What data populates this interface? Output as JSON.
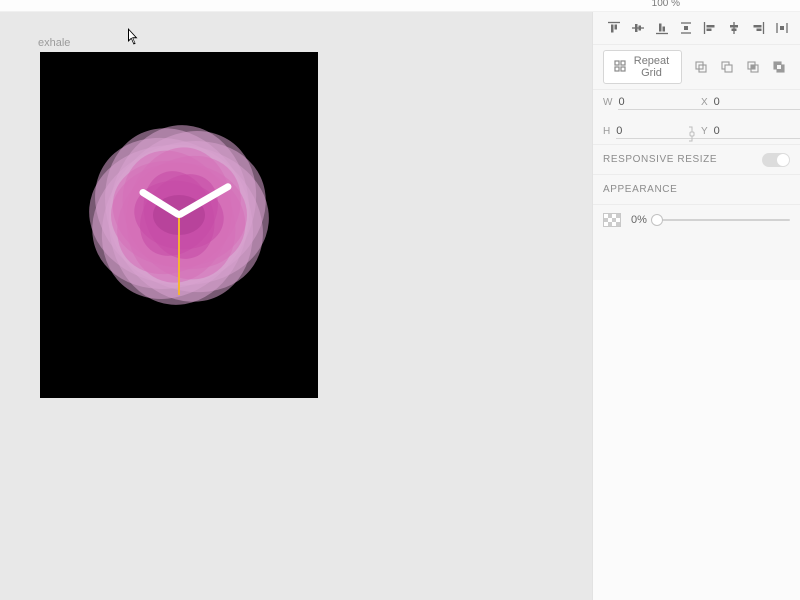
{
  "topbar": {
    "zoom_label": "100 %"
  },
  "artboard": {
    "label": "exhale"
  },
  "panel": {
    "repeat_grid_label": "Repeat Grid",
    "transform": {
      "w_label": "W",
      "w_value": "0",
      "h_label": "H",
      "h_value": "0",
      "x_label": "X",
      "x_value": "0",
      "y_label": "Y",
      "y_value": "0"
    },
    "responsive_label": "RESPONSIVE RESIZE",
    "appearance_label": "APPEARANCE",
    "opacity_value": "0%"
  },
  "icons": {
    "align_top": "align-top-icon",
    "align_vmid": "align-vertical-middle-icon",
    "align_bottom": "align-bottom-icon",
    "align_vspace": "distribute-vertical-icon",
    "align_left": "align-left-icon",
    "align_hmid": "align-horizontal-middle-icon",
    "align_right": "align-right-icon",
    "align_hspace": "distribute-horizontal-icon",
    "repeat_grid": "grid-icon",
    "bool_union": "boolean-union-icon",
    "bool_subtract": "boolean-subtract-icon",
    "bool_intersect": "boolean-intersect-icon",
    "bool_exclude": "boolean-exclude-icon",
    "lock_aspect": "lock-aspect-icon",
    "opacity_chip": "transparency-chip-icon"
  }
}
